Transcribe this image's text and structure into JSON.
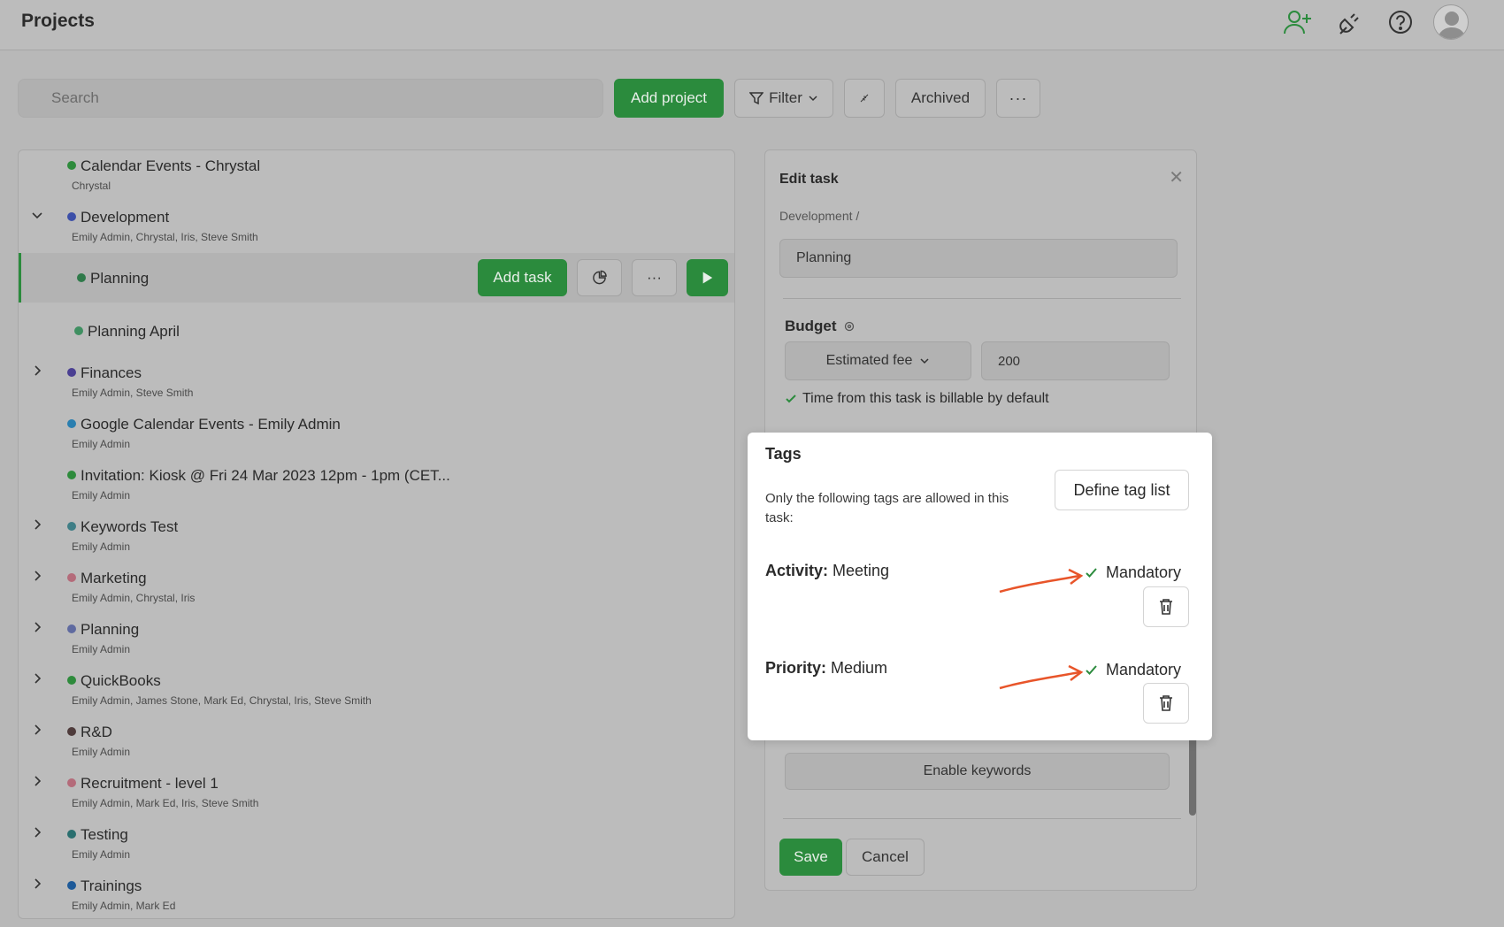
{
  "header": {
    "title": "Projects"
  },
  "toolbar": {
    "search_placeholder": "Search",
    "add_project": "Add project",
    "filter": "Filter",
    "archived": "Archived"
  },
  "projects": [
    {
      "name": "Calendar Events - Chrystal",
      "members": "Chrystal",
      "color": "#2e8b3c",
      "expandable": false
    },
    {
      "name": "Development",
      "members": "Emily Admin, Chrystal, Iris, Steve Smith",
      "color": "#3c4fa8",
      "expandable": true,
      "expanded": true
    },
    {
      "name": "Finances",
      "members": "Emily Admin, Steve Smith",
      "color": "#4a3f92",
      "expandable": true
    },
    {
      "name": "Google Calendar Events - Emily Admin",
      "members": "Emily Admin",
      "color": "#2a7fb0",
      "expandable": false
    },
    {
      "name": "Invitation: Kiosk @ Fri 24 Mar 2023 12pm - 1pm (CET...",
      "members": "Emily Admin",
      "color": "#2e8b3c",
      "expandable": false
    },
    {
      "name": "Keywords Test",
      "members": "Emily Admin",
      "color": "#3f7e86",
      "expandable": true
    },
    {
      "name": "Marketing",
      "members": "Emily Admin, Chrystal, Iris",
      "color": "#b46b7a",
      "expandable": true
    },
    {
      "name": "Planning",
      "members": "Emily Admin",
      "color": "#5f6aa0",
      "expandable": true
    },
    {
      "name": "QuickBooks",
      "members": "Emily Admin, James Stone, Mark Ed, Chrystal, Iris, Steve Smith",
      "color": "#2e8b3c",
      "expandable": true
    },
    {
      "name": "R&D",
      "members": "Emily Admin",
      "color": "#4e3b3b",
      "expandable": true
    },
    {
      "name": "Recruitment - level 1",
      "members": "Emily Admin, Mark Ed, Iris, Steve Smith",
      "color": "#b46b7a",
      "expandable": true
    },
    {
      "name": "Testing",
      "members": "Emily Admin",
      "color": "#2a6f6f",
      "expandable": true
    },
    {
      "name": "Trainings",
      "members": "Emily Admin, Mark Ed",
      "color": "#1e5a99",
      "expandable": true
    }
  ],
  "tasks": [
    {
      "name": "Planning",
      "color": "#2f7a4a"
    },
    {
      "name": "Planning April",
      "color": "#3f8f61"
    }
  ],
  "task_actions": {
    "add_task": "Add task"
  },
  "edit_task": {
    "title": "Edit task",
    "breadcrumb": "Development /",
    "task_name": "Planning",
    "budget_label": "Budget",
    "budget_type": "Estimated fee",
    "budget_value": "200",
    "billable_label": "Time from this task is billable by default",
    "enable_keywords": "Enable keywords",
    "save": "Save",
    "cancel": "Cancel"
  },
  "tags_card": {
    "title": "Tags",
    "description": "Only the following tags are allowed in this task:",
    "define_button": "Define tag list",
    "tags": [
      {
        "key": "Activity:",
        "value": "Meeting",
        "mandatory_label": "Mandatory",
        "mandatory": true
      },
      {
        "key": "Priority:",
        "value": "Medium",
        "mandatory_label": "Mandatory",
        "mandatory": true
      }
    ]
  },
  "colors": {
    "accent": "#2b8b3d",
    "arrow": "#e8552a"
  }
}
